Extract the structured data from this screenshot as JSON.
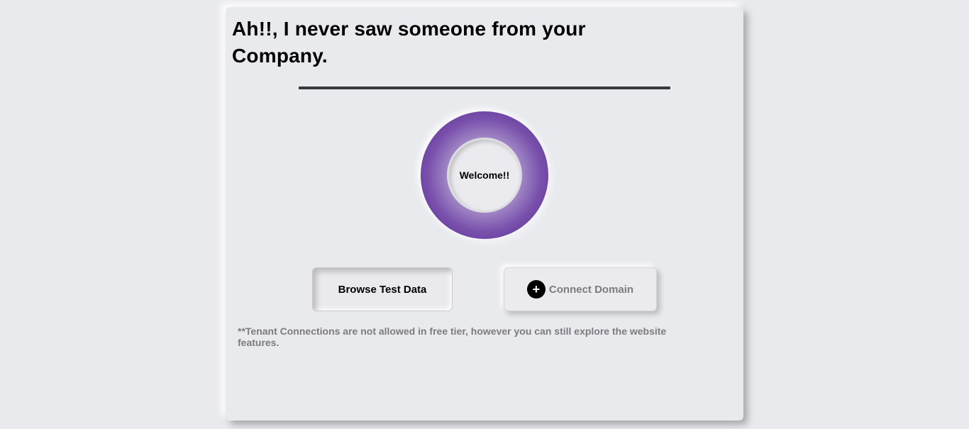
{
  "card": {
    "title": "Ah!!, I never saw someone from your Company.",
    "welcome_text": "Welcome!!",
    "browse_button_label": "Browse Test Data",
    "connect_button_label": "Connect Domain",
    "connect_button_icon": "plus-circle-icon",
    "footnote": "**Tenant Connections are not allowed in free tier, however you can still explore the website features."
  },
  "colors": {
    "background": "#e9eaee",
    "ring_dark": "#4e2189",
    "ring_light": "#c3b3d9",
    "muted_text": "#7b7b80",
    "divider": "#36383d"
  }
}
